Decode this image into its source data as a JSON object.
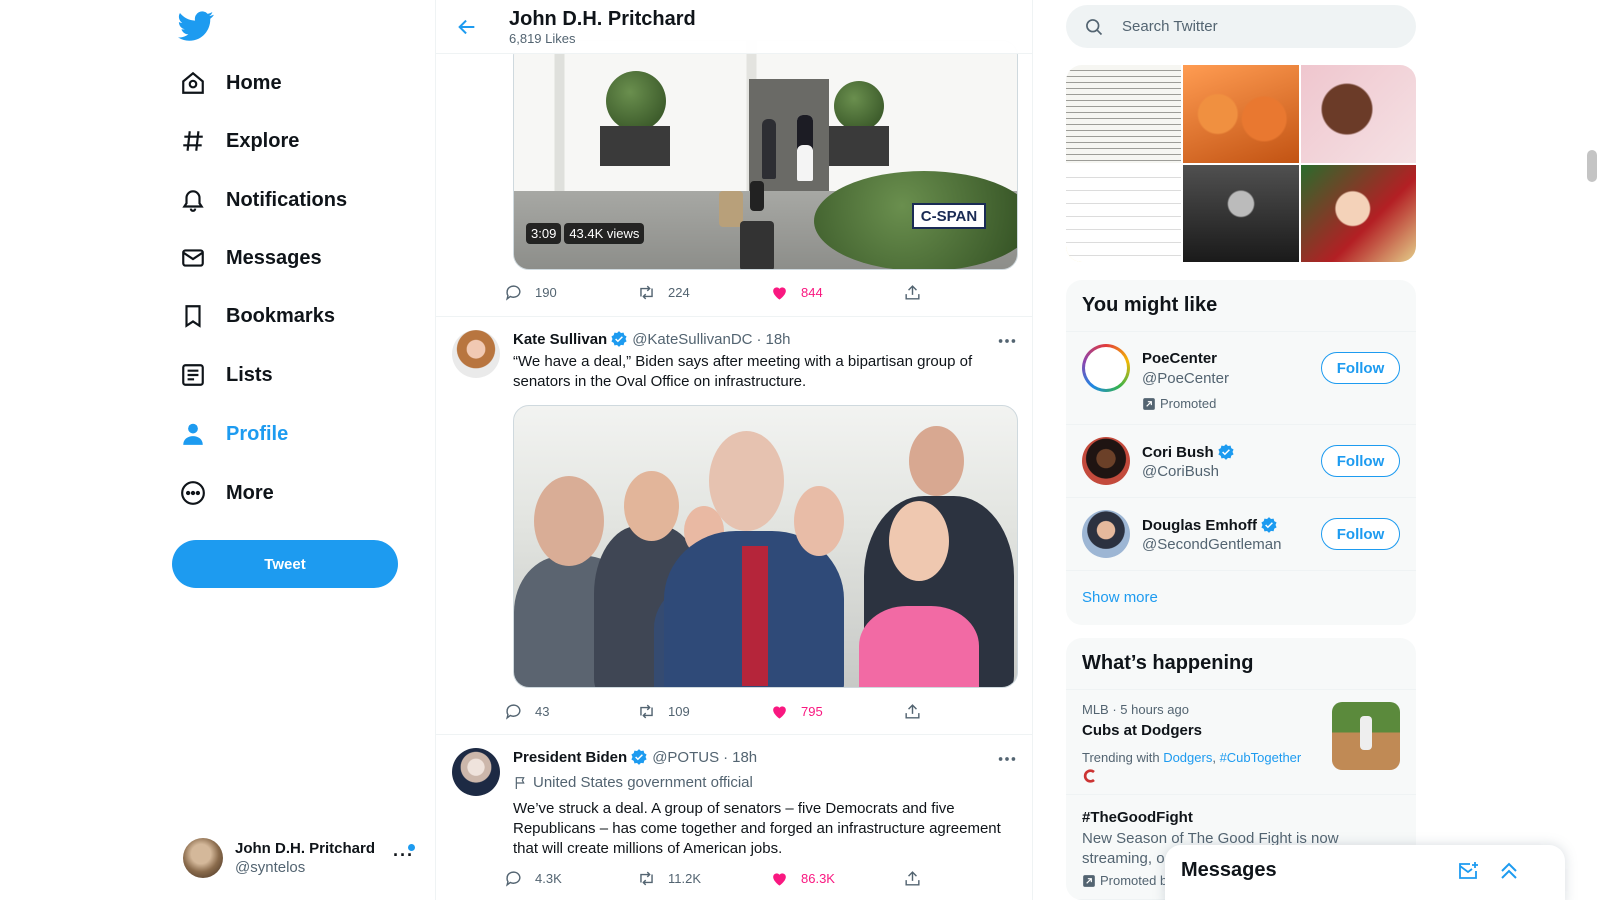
{
  "nav": {
    "items": [
      {
        "label": "Home",
        "icon": "home-icon"
      },
      {
        "label": "Explore",
        "icon": "hashtag-icon"
      },
      {
        "label": "Notifications",
        "icon": "bell-icon"
      },
      {
        "label": "Messages",
        "icon": "envelope-icon"
      },
      {
        "label": "Bookmarks",
        "icon": "bookmark-icon"
      },
      {
        "label": "Lists",
        "icon": "list-icon"
      },
      {
        "label": "Profile",
        "icon": "person-icon"
      },
      {
        "label": "More",
        "icon": "more-circle-icon"
      }
    ],
    "tweet_button": "Tweet"
  },
  "account": {
    "name": "John D.H. Pritchard",
    "handle": "@syntelos"
  },
  "header": {
    "title": "John D.H. Pritchard",
    "subtitle": "6,819 Likes"
  },
  "timeline": [
    {
      "video": {
        "duration": "3:09",
        "views": "43.4K views",
        "watermark": "C-SPAN"
      },
      "stats": {
        "replies": "190",
        "retweets": "224",
        "likes": "844"
      }
    },
    {
      "name": "Kate Sullivan",
      "handle": "@KateSullivanDC",
      "time": "18h",
      "text": "“We have a deal,” Biden says after meeting with a bipartisan group of senators in the Oval Office on infrastructure.",
      "stats": {
        "replies": "43",
        "retweets": "109",
        "likes": "795"
      }
    },
    {
      "name": "President Biden",
      "handle": "@POTUS",
      "time": "18h",
      "label": "United States government official",
      "text": "We’ve struck a deal. A group of senators – five Democrats and five Republicans – has come together and forged an infrastructure agreement that will create millions of American jobs.",
      "stats": {
        "replies": "4.3K",
        "retweets": "11.2K",
        "likes": "86.3K"
      }
    }
  ],
  "search": {
    "placeholder": "Search Twitter"
  },
  "who_to_follow": {
    "title": "You might like",
    "accounts": [
      {
        "name": "PoeCenter",
        "handle": "@PoeCenter",
        "promoted": "Promoted",
        "button": "Follow"
      },
      {
        "name": "Cori Bush",
        "handle": "@CoriBush",
        "button": "Follow"
      },
      {
        "name": "Douglas Emhoff",
        "handle": "@SecondGentleman",
        "button": "Follow"
      }
    ],
    "show_more": "Show more"
  },
  "happening": {
    "title": "What’s happening",
    "trends": [
      {
        "meta": "MLB · 5 hours ago",
        "title": "Cubs at Dodgers",
        "with_label": "Trending with",
        "with_1": "Dodgers",
        "with_2": "#CubTogether"
      },
      {
        "title": "#TheGoodFight",
        "desc": "New Season of The Good Fight is now streaming, o",
        "promoted": "Promoted b"
      }
    ]
  },
  "messages_drawer": {
    "title": "Messages"
  },
  "colors": {
    "accent": "#1d9bf0",
    "like": "#f91880",
    "text": "#0f1419",
    "muted": "#536471"
  }
}
